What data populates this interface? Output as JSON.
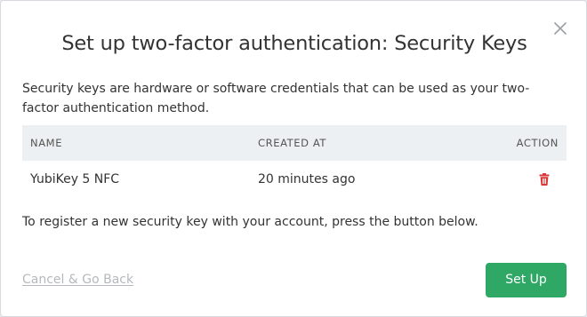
{
  "dialog": {
    "title": "Set up two-factor authentication: Security Keys",
    "description": "Security keys are hardware or software credentials that can be used as your two-factor authentication method.",
    "close_icon": "close-icon"
  },
  "table": {
    "headers": {
      "name": "NAME",
      "created": "CREATED AT",
      "action": "ACTION"
    },
    "rows": [
      {
        "name": "YubiKey 5 NFC",
        "created": "20 minutes ago",
        "action_icon": "trash-icon"
      }
    ]
  },
  "register_text": "To register a new security key with your account, press the button below.",
  "footer": {
    "cancel_label": "Cancel & Go Back",
    "setup_label": "Set Up"
  },
  "colors": {
    "primary_button": "#2fa866",
    "delete_icon": "#d9383a",
    "header_bg": "#edf0f2",
    "muted_link": "#b5b9bd"
  }
}
